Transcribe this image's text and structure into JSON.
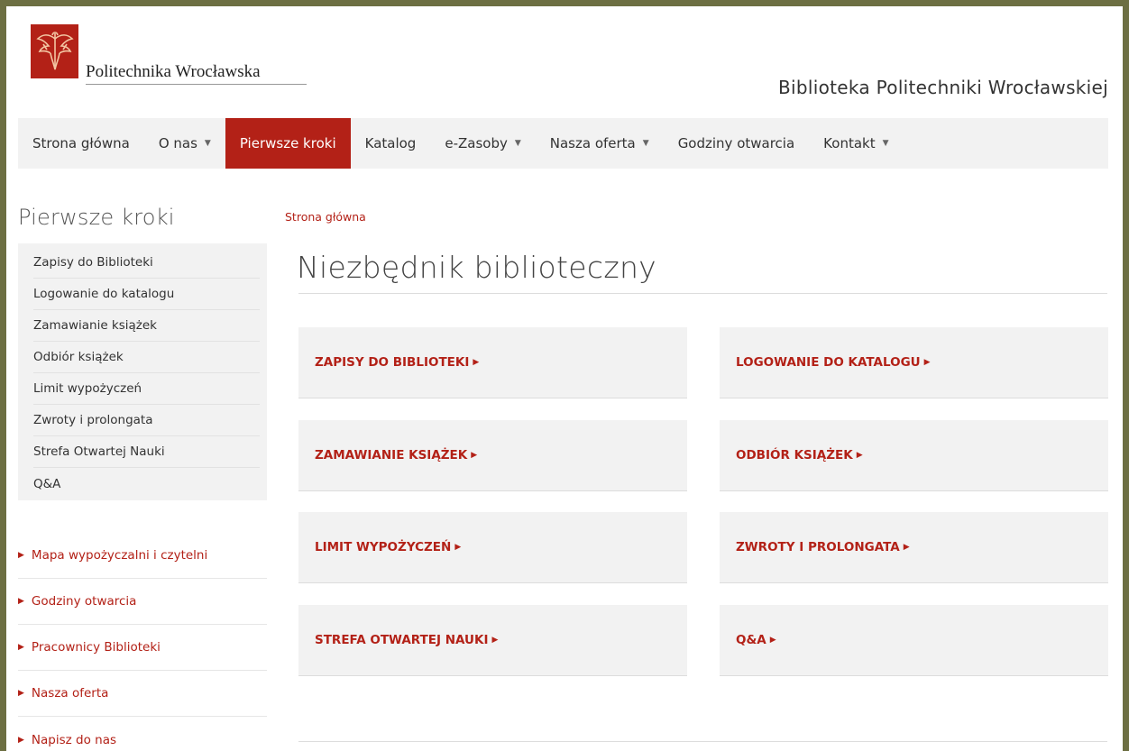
{
  "header": {
    "logo_text": "Politechnika Wrocławska",
    "site_title": "Biblioteka Politechniki Wrocławskiej"
  },
  "nav": [
    {
      "label": "Strona główna",
      "caret": false
    },
    {
      "label": "O nas",
      "caret": true
    },
    {
      "label": "Pierwsze kroki",
      "caret": false,
      "active": true
    },
    {
      "label": "Katalog",
      "caret": false
    },
    {
      "label": "e-Zasoby",
      "caret": true
    },
    {
      "label": "Nasza oferta",
      "caret": true
    },
    {
      "label": "Godziny otwarcia",
      "caret": false
    },
    {
      "label": "Kontakt",
      "caret": true
    }
  ],
  "sidebar": {
    "heading": "Pierwsze kroki",
    "menu": [
      "Zapisy do Biblioteki",
      "Logowanie do katalogu",
      "Zamawianie książek",
      "Odbiór książek",
      "Limit wypożyczeń",
      "Zwroty i prolongata",
      "Strefa Otwartej Nauki",
      "Q&A"
    ],
    "links": [
      "Mapa wypożyczalni i czytelni",
      "Godziny otwarcia",
      "Pracownicy Biblioteki",
      "Nasza oferta",
      "Napisz do nas"
    ]
  },
  "main": {
    "breadcrumb": "Strona główna",
    "title": "Niezbędnik biblioteczny",
    "tiles": [
      "ZAPISY DO BIBLIOTEKI",
      "LOGOWANIE DO KATALOGU",
      "ZAMAWIANIE KSIĄŻEK",
      "ODBIÓR KSIĄŻEK",
      "LIMIT WYPOŻYCZEŃ",
      "ZWROTY I PROLONGATA",
      "STREFA OTWARTEJ NAUKI",
      "Q&A"
    ]
  },
  "colors": {
    "accent": "#b32117",
    "frame": "#6d6f43",
    "panel": "#f2f2f2"
  },
  "icons": {
    "caret": "caret-down-icon",
    "link_arrow": "triangle-right-icon",
    "logo": "eagle-crest-icon"
  }
}
